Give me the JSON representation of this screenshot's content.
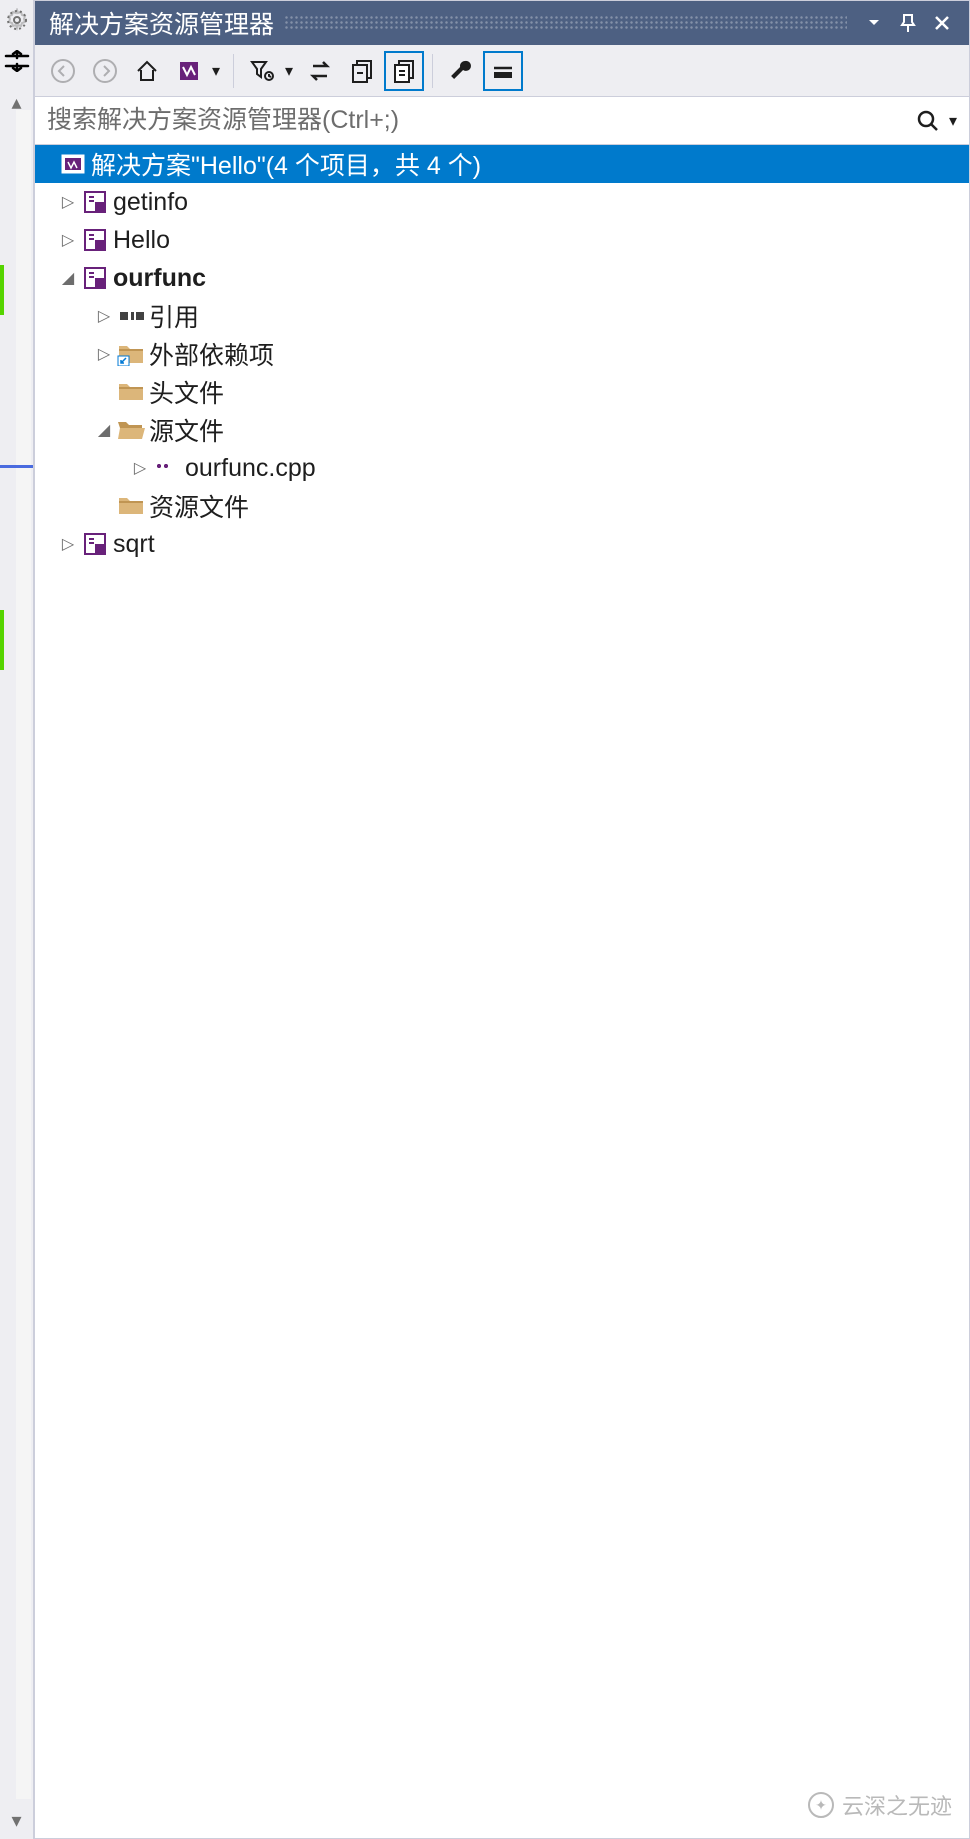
{
  "panel": {
    "title": "解决方案资源管理器"
  },
  "search": {
    "placeholder": "搜索解决方案资源管理器(Ctrl+;)"
  },
  "solution": {
    "label": "解决方案\"Hello\"(4 个项目，共 4 个)"
  },
  "tree": {
    "projects": [
      {
        "label": "getinfo"
      },
      {
        "label": "Hello"
      },
      {
        "label": "ourfunc",
        "bold": true
      },
      {
        "label": "sqrt"
      }
    ],
    "folders": {
      "references": "引用",
      "external": "外部依赖项",
      "headers": "头文件",
      "sources": "源文件",
      "resources": "资源文件"
    },
    "files": {
      "ourfunc_cpp": "ourfunc.cpp"
    }
  },
  "watermark": "云深之无迹"
}
